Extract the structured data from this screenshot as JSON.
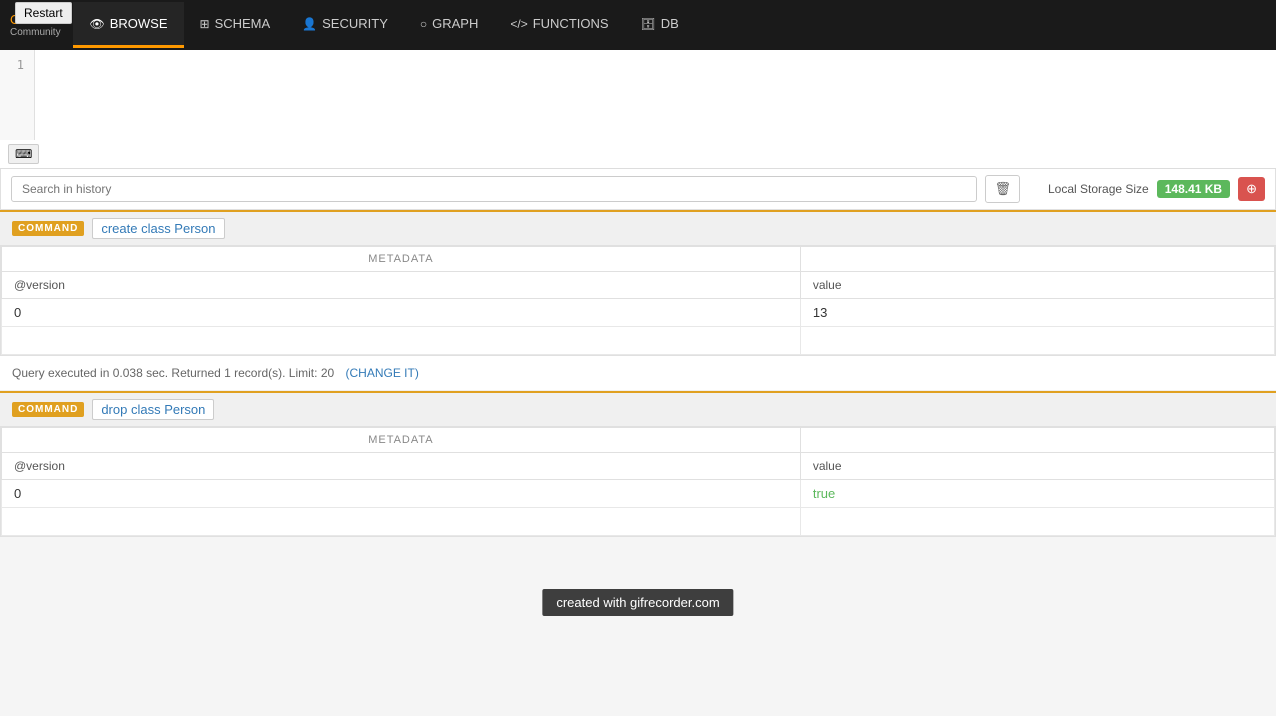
{
  "navbar": {
    "brand": "OrientDB",
    "community": "Community",
    "items": [
      {
        "id": "browse",
        "label": "BROWSE",
        "icon": "👁",
        "active": true
      },
      {
        "id": "schema",
        "label": "SCHEMA",
        "icon": "⊞",
        "active": false
      },
      {
        "id": "security",
        "label": "SECURITY",
        "icon": "👤",
        "active": false
      },
      {
        "id": "graph",
        "label": "GRAPH",
        "icon": "○",
        "active": false
      },
      {
        "id": "functions",
        "label": "FUNCTIONS",
        "icon": "</>",
        "active": false
      },
      {
        "id": "db",
        "label": "DB",
        "icon": "🗄",
        "active": false
      }
    ]
  },
  "restart_button": "Restart",
  "editor": {
    "line_number": "1",
    "content": ""
  },
  "history": {
    "search_placeholder": "Search in history"
  },
  "storage": {
    "label": "Local Storage Size",
    "size": "148.41 KB"
  },
  "commands": [
    {
      "id": "cmd1",
      "badge": "COMMAND",
      "link_text": "create class Person",
      "metadata_header": "METADATA",
      "columns": [
        "@version",
        "value"
      ],
      "rows": [
        [
          "0",
          "13"
        ]
      ],
      "query_info": "Query executed in 0.038 sec. Returned 1 record(s). Limit: 20",
      "change_it": "(CHANGE IT)"
    },
    {
      "id": "cmd2",
      "badge": "COMMAND",
      "link_text": "drop class Person",
      "metadata_header": "METADATA",
      "columns": [
        "@version",
        "value"
      ],
      "rows": [
        [
          "0",
          "true"
        ]
      ],
      "query_info": "",
      "change_it": ""
    }
  ],
  "watermark": "created with gifrecorder.com"
}
